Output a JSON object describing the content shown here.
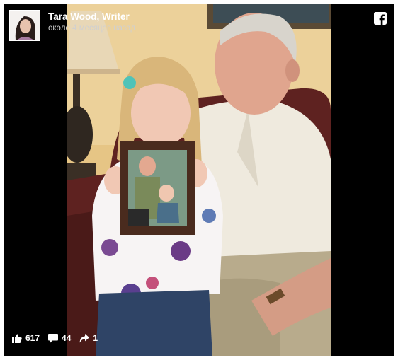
{
  "post": {
    "author": "Tara Wood, Writer",
    "timestamp": "около 4 месяцев назад"
  },
  "brand_icon": "facebook-icon",
  "photo": {
    "description_icon": "photo"
  },
  "actions": {
    "likes": "617",
    "comments": "44",
    "shares": "1"
  },
  "colors": {
    "frame_background": "#000000",
    "text": "#ffffff",
    "muted_text": "#d0d0d0"
  }
}
